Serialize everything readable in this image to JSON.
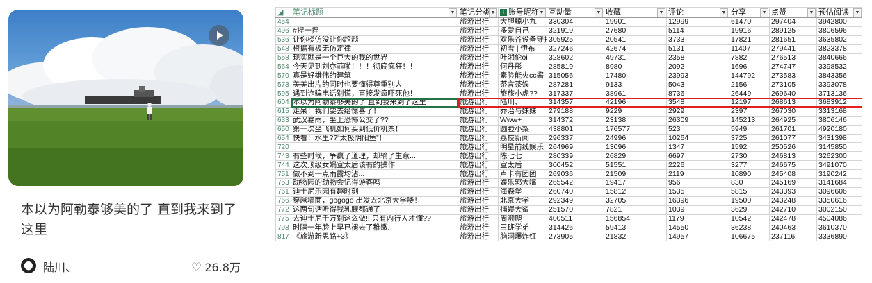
{
  "card": {
    "title": "本以为阿勒泰够美的了 直到我来到了这里",
    "author": "陆川、",
    "likes": "26.8万",
    "icons": {
      "play": "play-icon",
      "heart": "heart-icon",
      "avatar": "avatar"
    }
  },
  "sheet": {
    "headers": [
      "笔记标题",
      "笔记分类",
      "账号昵称",
      "互动量",
      "收藏",
      "评论",
      "分享",
      "点赞",
      "预估阅读"
    ],
    "top_partial_row": [
      "",
      "旅游出行",
      "",
      "",
      "",
      "",
      "",
      "",
      ""
    ],
    "rows": [
      {
        "rn": "454",
        "c": [
          "",
          "旅游出行",
          "大胆鲸小九",
          "330304",
          "19901",
          "12999",
          "61470",
          "297404",
          "3942800"
        ]
      },
      {
        "rn": "496",
        "c": [
          "#捏一捏",
          "旅游出行",
          "多爱自己",
          "321919",
          "27680",
          "5114",
          "19916",
          "289125",
          "3806596"
        ]
      },
      {
        "rn": "536",
        "c": [
          "让你楼仿没让你超越",
          "旅游出行",
          "欢乐谷设备守护者",
          "305925",
          "20541",
          "3733",
          "17821",
          "281651",
          "3635802"
        ]
      },
      {
        "rn": "548",
        "c": [
          "根据有板无仿定律",
          "旅游出行",
          "初雪 | 伊布",
          "327246",
          "42674",
          "5131",
          "11407",
          "279441",
          "3823378"
        ]
      },
      {
        "rn": "558",
        "c": [
          "现实就是一个巨大的我的世界",
          "旅游出行",
          "叶湘伦oi",
          "328602",
          "49731",
          "2358",
          "7882",
          "276513",
          "3840666"
        ]
      },
      {
        "rn": "564",
        "c": [
          "今天见到刘亦菲啦！！！彻底疯狂！！",
          "旅游出行",
          "何丹彤",
          "285819",
          "8980",
          "2092",
          "1696",
          "274747",
          "3398532"
        ]
      },
      {
        "rn": "570",
        "c": [
          "真是好雄伟的建筑",
          "旅游出行",
          "素脸能火cc酱",
          "315056",
          "17480",
          "23993",
          "144792",
          "273583",
          "3843356"
        ]
      },
      {
        "rn": "573",
        "c": [
          "美美出片的同时也要懂得尊重别人",
          "旅游出行",
          "茶言茶娱",
          "287281",
          "9133",
          "5043",
          "2156",
          "273105",
          "3393078"
        ]
      },
      {
        "rn": "595",
        "c": [
          "遇到诈骗电话别慌，直接发疯吓死他！",
          "旅游出行",
          "旅旅小虎??",
          "317337",
          "38961",
          "8736",
          "26449",
          "269640",
          "3713136"
        ]
      },
      {
        "rn": "604",
        "c": [
          "本以为阿勒泰够美的了 直到我来到了这里",
          "旅游出行",
          "陆川、",
          "314357",
          "42196",
          "3548",
          "12197",
          "268613",
          "3683912"
        ],
        "highlight": true
      },
      {
        "rn": "615",
        "c": [
          "走呆！我们要去给惊喜了！",
          "旅游出行",
          "乔治与妹妹",
          "279188",
          "9229",
          "2929",
          "2397",
          "267030",
          "3313168"
        ]
      },
      {
        "rn": "633",
        "c": [
          "武汉暴雨，坐上恐怖公交了??",
          "旅游出行",
          "Www+",
          "314372",
          "23138",
          "26309",
          "145213",
          "264925",
          "3806146"
        ]
      },
      {
        "rn": "650",
        "c": [
          "第一次坐飞机如何买到低价机票！",
          "旅游出行",
          "圆脸小梨",
          "438801",
          "176577",
          "523",
          "5949",
          "261701",
          "4920180"
        ]
      },
      {
        "rn": "654",
        "c": [
          "快看！水里??“太极阴阳鱼”！",
          "旅游出行",
          "荔枝新闻",
          "296337",
          "24996",
          "10264",
          "3725",
          "261077",
          "3431398"
        ]
      },
      {
        "rn": "720",
        "c": [
          "",
          "旅游出行",
          "明星前线娱乐",
          "264969",
          "13096",
          "1347",
          "1592",
          "250526",
          "3145850"
        ]
      },
      {
        "rn": "743",
        "c": [
          "有些时候，争赢了道理，却输了生意...",
          "旅游出行",
          "陈七七",
          "280339",
          "26829",
          "6697",
          "2730",
          "246813",
          "3262300"
        ]
      },
      {
        "rn": "744",
        "c": [
          "这次顶级女娲宣太后该有的操作!",
          "旅游出行",
          "宣太后",
          "300452",
          "51551",
          "2226",
          "3277",
          "246675",
          "3491070"
        ]
      },
      {
        "rn": "751",
        "c": [
          "做不到一点雨露均沾...",
          "旅游出行",
          "卢卡有团团",
          "269036",
          "21509",
          "2119",
          "10890",
          "245408",
          "3190242"
        ]
      },
      {
        "rn": "753",
        "c": [
          "动物园的动物会记得游客吗",
          "旅游出行",
          "娱乐郭大嘴",
          "265542",
          "19417",
          "956",
          "830",
          "245169",
          "3141684"
        ]
      },
      {
        "rn": "761",
        "c": [
          "迪士尼乐园有趣时刻",
          "旅游出行",
          "海森堡",
          "260740",
          "15812",
          "1535",
          "5815",
          "243393",
          "3096606"
        ]
      },
      {
        "rn": "766",
        "c": [
          "穿越墙面，gogogo 出发去北京大学喽！",
          "旅游出行",
          "北京大学",
          "292349",
          "32705",
          "16396",
          "19500",
          "243248",
          "3350616"
        ]
      },
      {
        "rn": "772",
        "c": [
          "这两句话听得我乳腺都通了",
          "旅游出行",
          "捕娱大鲨",
          "251570",
          "7821",
          "1039",
          "3629",
          "242710",
          "3002150"
        ]
      },
      {
        "rn": "775",
        "c": [
          "去迪士尼千万别这么做!! 只有内行人才懂??",
          "旅游出行",
          "周濒爬",
          "400511",
          "156854",
          "1179",
          "10542",
          "242478",
          "4504086"
        ]
      },
      {
        "rn": "798",
        "c": [
          "时隔一年脸上早已褪去了稚嫩.",
          "旅游出行",
          "三班学弟",
          "314426",
          "59413",
          "14550",
          "36238",
          "240463",
          "3610370"
        ]
      },
      {
        "rn": "817",
        "c": [
          "《旅游新思路+3》",
          "旅游出行",
          "脑洞爆炸红",
          "273905",
          "21832",
          "14957",
          "106675",
          "237116",
          "3336890"
        ]
      }
    ]
  }
}
